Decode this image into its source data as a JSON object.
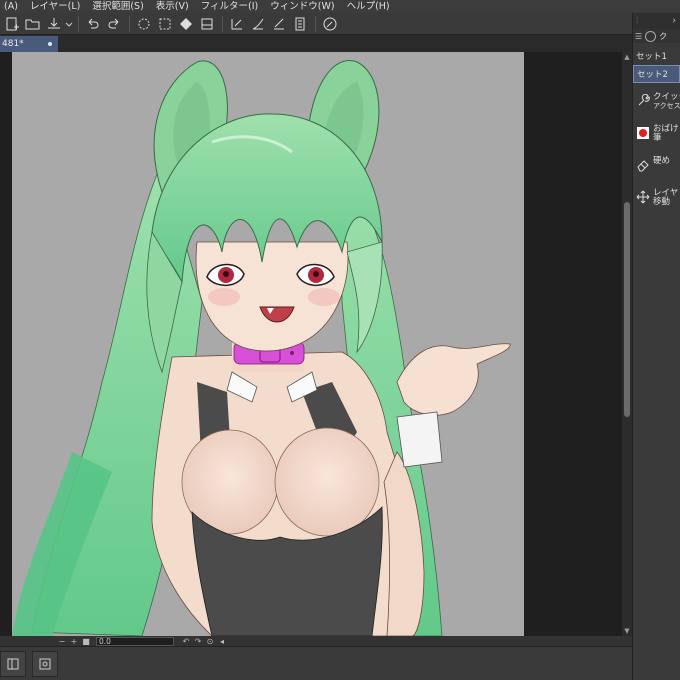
{
  "menu": [
    "(A)",
    "レイヤー(L)",
    "選択範囲(S)",
    "表示(V)",
    "フィルター(I)",
    "ウィンドウ(W)",
    "ヘルプ(H)"
  ],
  "toolbar": {
    "icons": [
      "new-file-icon",
      "open-file-icon",
      "save-icon",
      "dropdown-icon",
      "undo-icon",
      "redo-icon",
      "clear-icon",
      "fill-icon",
      "fill-bucket-icon",
      "transform-icon",
      "ruler-icon",
      "snap-ruler-icon",
      "snap-curve-icon",
      "snap-grid-icon",
      "pen-pressure-icon"
    ]
  },
  "document_tab": {
    "label": "481*"
  },
  "canvas": {
    "background": "#a9a9a9",
    "hair_color": "#8fd6a0",
    "skin_color": "#f6e0d2",
    "suit_color": "#4b4b4b",
    "collar_color": "#d84fd8",
    "eye_color": "#b3263f"
  },
  "statusbar": {
    "zoom": "0.0"
  },
  "right_panel": {
    "tab_label": "ク",
    "sets": [
      "セット1",
      "セット2"
    ],
    "active_set": 1,
    "items": [
      {
        "icon": "quick-access-icon",
        "line1": "クイック",
        "line2": "アクセス"
      },
      {
        "icon": "obake-brush-icon",
        "line1": "おばけ",
        "line2": "筆"
      },
      {
        "icon": "eraser-icon",
        "line1": "硬め",
        "line2": ""
      },
      {
        "icon": "move-layer-icon",
        "line1": "レイヤ",
        "line2": "移動"
      }
    ]
  },
  "colors": {
    "accent": "#4a5a7a",
    "panel": "#3a3a3a",
    "workspace": "#1f1f1f"
  }
}
